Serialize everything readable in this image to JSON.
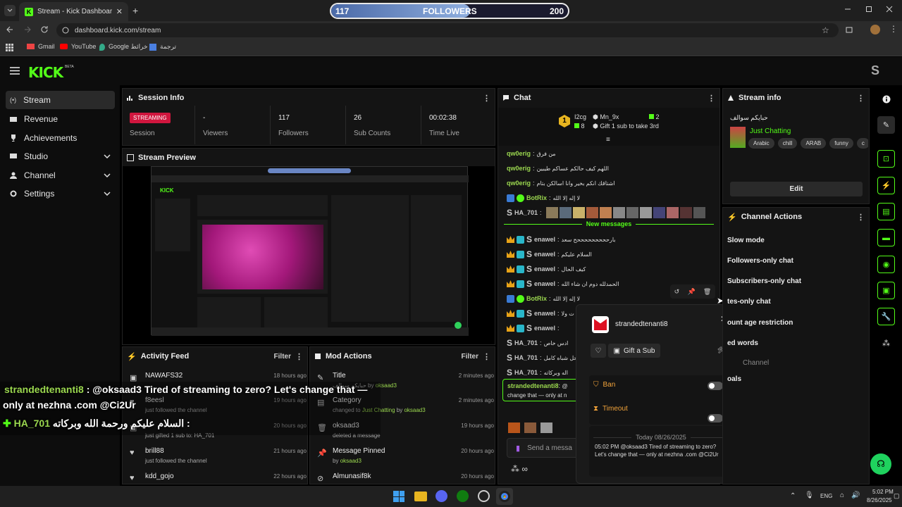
{
  "browser": {
    "tab_title": "Stream - Kick Dashboard",
    "url": "dashboard.kick.com/stream",
    "bookmarks": [
      "Gmail",
      "YouTube",
      "Google خرائط",
      "ترجمة"
    ]
  },
  "follower_goal": {
    "current": "117",
    "label": "FOLLOWERS",
    "target": "200",
    "progress": 0.585
  },
  "sidebar": {
    "logo": "KICK",
    "beta": "BETA",
    "items": [
      {
        "label": "Stream",
        "icon": "broadcast-icon"
      },
      {
        "label": "Revenue",
        "icon": "revenue-icon"
      },
      {
        "label": "Achievements",
        "icon": "trophy-icon"
      },
      {
        "label": "Studio",
        "icon": "studio-icon"
      },
      {
        "label": "Channel",
        "icon": "channel-icon"
      },
      {
        "label": "Settings",
        "icon": "gear-icon"
      }
    ]
  },
  "avatar_letter": "S",
  "session": {
    "title": "Session Info",
    "status": "STREAMING",
    "session_label": "Session",
    "stats": [
      {
        "value": "-",
        "label": "Viewers"
      },
      {
        "value": "117",
        "label": "Followers"
      },
      {
        "value": "26",
        "label": "Sub Counts"
      },
      {
        "value": "00:02:38",
        "label": "Time Live"
      }
    ]
  },
  "preview": {
    "title": "Stream Preview"
  },
  "activity": {
    "title": "Activity Feed",
    "filter": "Filter",
    "items": [
      {
        "name": "NAWAFS32",
        "sub": "",
        "time": "18 hours ago",
        "icon": "gift-icon"
      },
      {
        "name": "f8eesl",
        "sub": "just followed the channel",
        "time": "19 hours ago",
        "icon": "heart-icon"
      },
      {
        "name": "",
        "sub": "just gifted 1 sub to: HA_701",
        "time": "20 hours ago",
        "icon": "gift-icon"
      },
      {
        "name": "brill88",
        "sub": "just followed the channel",
        "time": "21 hours ago",
        "icon": "heart-icon"
      },
      {
        "name": "kdd_gojo",
        "sub": "",
        "time": "22 hours ago",
        "icon": "heart-icon"
      }
    ]
  },
  "mod": {
    "title": "Mod Actions",
    "filter": "Filter",
    "items": [
      {
        "name": "Title",
        "sub": "حبايكم سوالف",
        "by": "by",
        "user": "oksaad3",
        "time": "2 minutes ago",
        "icon": "title-icon"
      },
      {
        "name": "Category",
        "sub": "changed to",
        "cat": "Just Chatting",
        "by": "by",
        "user": "oksaad3",
        "time": "2 minutes ago",
        "icon": "category-icon"
      },
      {
        "name": "oksaad3",
        "sub": "deleted a message",
        "time": "19 hours ago",
        "icon": "trash-icon"
      },
      {
        "name": "Message Pinned",
        "sub": "by",
        "user": "oksaad3",
        "time": "20 hours ago",
        "icon": "pin-icon"
      },
      {
        "name": "Almunasif8k",
        "sub": "",
        "time": "20 hours ago",
        "icon": "ban-icon"
      }
    ]
  },
  "chat": {
    "title": "Chat",
    "leader1": {
      "name": "I2cg",
      "rank": "1",
      "count": "8"
    },
    "leader2": {
      "name": "Mn_9x",
      "count": "2"
    },
    "gift_prompt": "Gift 1 sub to take 3rd",
    "new_messages": "New messages",
    "lines": [
      {
        "user": "qw0erig",
        "msg": "من فرق"
      },
      {
        "user": "qw0erig",
        "msg": "اللهم كيف حالكم عساكم طيبين"
      },
      {
        "user": "qw0erig",
        "msg": "اشتاقك انكم بخير وانا اسالكن بتام"
      },
      {
        "user": "BotRix",
        "msg": "لا إله إلا الله"
      },
      {
        "user": "HA_701",
        "msg": ""
      },
      {
        "user": "enawel",
        "msg": "بارحححححححححح سعد"
      },
      {
        "user": "enawel",
        "msg": "السلام عليكم"
      },
      {
        "user": "enawel",
        "msg": "كيف الحال"
      },
      {
        "user": "enawel",
        "msg": "الحمدلله دوم ان شاء الله"
      },
      {
        "user": "BotRix",
        "msg": "لا إله إلا الله"
      },
      {
        "user": "enawel",
        "msg": "ت ولا"
      },
      {
        "user": "enawel",
        "msg": ""
      },
      {
        "user": "HA_701",
        "msg": "ادس خاص"
      },
      {
        "user": "HA_701",
        "msg": "حل شباه كامل"
      },
      {
        "user": "HA_701",
        "msg": "اله وبركاته"
      }
    ],
    "pinned_user": "strandedtenanti8",
    "pinned_msg": "@",
    "pinned_msg2": "change that — only at n",
    "send_placeholder": "Send a messa"
  },
  "usercard": {
    "username": "strandedtenanti8",
    "gift": "Gift a Sub",
    "ban": "Ban",
    "timeout": "Timeout",
    "date": "Today 08/26/2025",
    "time": "05:02 PM",
    "message": "@oksaad3 Tired of streaming to zero? Let's change that — only at nezhna .com @Ci2Ur"
  },
  "stream_info": {
    "title": "Stream info",
    "stream_title": "حبايكم سوالف",
    "category": "Just Chatting",
    "tags": [
      "Arabic",
      "chill",
      "ARAB",
      "funny",
      "c"
    ],
    "edit": "Edit"
  },
  "channel_actions": {
    "title": "Channel Actions",
    "items": [
      {
        "label": "Slow mode",
        "type": "chevron"
      },
      {
        "label": "Followers-only chat",
        "type": "chevron"
      },
      {
        "label": "Subscribers-only chat",
        "type": "toggle"
      },
      {
        "label": "tes-only chat",
        "type": "toggle"
      },
      {
        "label": "ount age restriction",
        "type": "chevron"
      },
      {
        "label": "ed words",
        "type": "chevron"
      },
      {
        "label": "Channel",
        "type": "none"
      },
      {
        "label": "oals",
        "type": "chevron"
      }
    ]
  },
  "overlay": {
    "user1": "strandedtenanti8",
    "msg1": ": @oksaad3 Tired of streaming to zero? Let's change that —",
    "msg1b": "only at nezhna .com @Ci2Ur",
    "user2": "HA_701",
    "msg2": "السلام عليكم ورحمة الله وبركاته :"
  },
  "taskbar": {
    "lang": "ENG",
    "time": "5:02 PM",
    "date": "8/26/2025"
  },
  "colors": {
    "accent": "#53fc18",
    "streaming": "#d0163e",
    "bg": "#141414"
  }
}
